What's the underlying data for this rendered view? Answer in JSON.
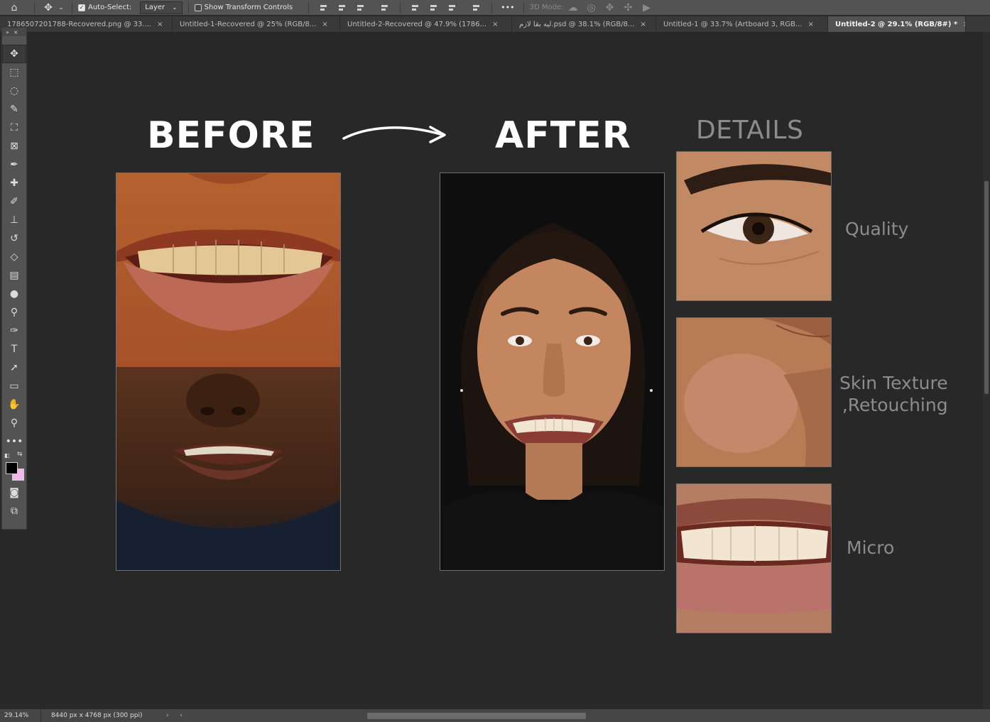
{
  "options_bar": {
    "home_icon": "home-icon",
    "move_icon": "move-icon",
    "auto_select_label": "Auto-Select:",
    "auto_select_checked": true,
    "layer_dropdown_value": "Layer",
    "show_transform_label": "Show Transform Controls",
    "show_transform_checked": false,
    "more_label": "•••",
    "mode_3d_label": "3D Mode:"
  },
  "tabs": [
    {
      "label": "1786507201788-Recovered.png @ 33....",
      "active": false
    },
    {
      "label": "Untitled-1-Recovered @ 25% (RGB/8...",
      "active": false
    },
    {
      "label": "Untitled-2-Recovered @ 47.9% (1786...",
      "active": false
    },
    {
      "label": "ليه بقا لازم.psd @ 38.1% (RGB/8...",
      "active": false
    },
    {
      "label": "Untitled-1 @ 33.7% (Artboard 3, RGB...",
      "active": false
    },
    {
      "label": "Untitled-2 @ 29.1% (RGB/8#) *",
      "active": true
    }
  ],
  "tab_close": "×",
  "toolbar": {
    "tools": [
      {
        "name": "move-tool",
        "glyph": "✥",
        "selected": true
      },
      {
        "name": "marquee-tool",
        "glyph": "⬚",
        "selected": false
      },
      {
        "name": "lasso-tool",
        "glyph": "◌",
        "selected": false
      },
      {
        "name": "quick-select-tool",
        "glyph": "✎",
        "selected": false
      },
      {
        "name": "crop-tool",
        "glyph": "⛶",
        "selected": false
      },
      {
        "name": "frame-tool",
        "glyph": "⊠",
        "selected": false
      },
      {
        "name": "eyedropper-tool",
        "glyph": "✒",
        "selected": false
      },
      {
        "name": "healing-brush-tool",
        "glyph": "✚",
        "selected": false
      },
      {
        "name": "brush-tool",
        "glyph": "✐",
        "selected": false
      },
      {
        "name": "clone-stamp-tool",
        "glyph": "⊥",
        "selected": false
      },
      {
        "name": "history-brush-tool",
        "glyph": "↺",
        "selected": false
      },
      {
        "name": "eraser-tool",
        "glyph": "◇",
        "selected": false
      },
      {
        "name": "gradient-tool",
        "glyph": "▤",
        "selected": false
      },
      {
        "name": "blur-tool",
        "glyph": "●",
        "selected": false
      },
      {
        "name": "dodge-tool",
        "glyph": "⚲",
        "selected": false
      },
      {
        "name": "pen-tool",
        "glyph": "✑",
        "selected": false
      },
      {
        "name": "type-tool",
        "glyph": "T",
        "selected": false
      },
      {
        "name": "path-select-tool",
        "glyph": "➚",
        "selected": false
      },
      {
        "name": "rectangle-tool",
        "glyph": "▭",
        "selected": false
      },
      {
        "name": "hand-tool",
        "glyph": "✋",
        "selected": false
      },
      {
        "name": "zoom-tool",
        "glyph": "⚲",
        "selected": false
      },
      {
        "name": "edit-toolbar",
        "glyph": "•••",
        "selected": false
      }
    ],
    "bottom_tools": [
      {
        "name": "quick-mask-tool",
        "glyph": "◙"
      },
      {
        "name": "screen-mode-tool",
        "glyph": "⧉"
      }
    ],
    "foreground_color": "#000000",
    "background_color": "#f3b6ea"
  },
  "canvas": {
    "before_title": "BEFORE",
    "after_title": "AFTER",
    "details_title": "DETAILS",
    "labels": [
      "Quality",
      "Skin Texture\n,Retouching",
      "Micro"
    ]
  },
  "status": {
    "zoom": "29.14%",
    "doc_info": "8440 px x 4768 px (300 ppi)",
    "arrow_right": "›",
    "arrow_left": "‹"
  }
}
